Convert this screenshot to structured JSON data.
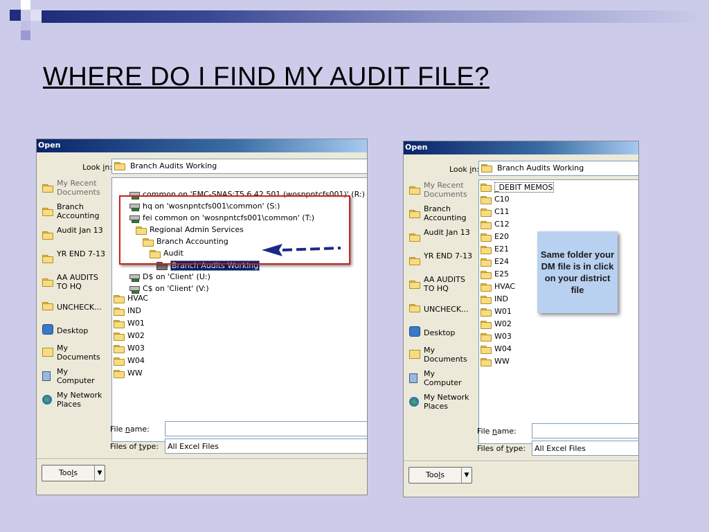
{
  "slide": {
    "title": "WHERE DO I FIND MY AUDIT FILE?",
    "background": "#ccccea",
    "accent": "#1f2d7a"
  },
  "dialog_left": {
    "title": "Open",
    "look_in_label": "Look in:",
    "look_in_value": "Branch Audits Working",
    "places": [
      {
        "label": "My Recent Documents",
        "icon": "folder-icon"
      },
      {
        "label": "Branch Accounting",
        "icon": "folder-icon"
      },
      {
        "label": "Audit Jan 13",
        "icon": "folder-icon"
      },
      {
        "label": "YR END 7-13",
        "icon": "folder-icon"
      },
      {
        "label": "AA AUDITS TO HQ",
        "icon": "folder-icon"
      },
      {
        "label": "UNCHECK...",
        "icon": "folder-icon"
      },
      {
        "label": "Desktop",
        "icon": "desktop-icon"
      },
      {
        "label": "My Documents",
        "icon": "my-documents-icon"
      },
      {
        "label": "My Computer",
        "icon": "my-computer-icon"
      },
      {
        "label": "My Network Places",
        "icon": "network-places-icon"
      }
    ],
    "tree": [
      {
        "label": "common on 'EMC-SNAS:T5.6.42.501 (wosnpntcfs001)' (R:)",
        "icon": "network-drive-icon"
      },
      {
        "label": "hq on 'wosnpntcfs001\\common' (S:)",
        "icon": "network-drive-icon"
      },
      {
        "label": "fei common on 'wosnpntcfs001\\common' (T:)",
        "icon": "network-drive-icon"
      },
      {
        "label": "Regional Admin Services",
        "icon": "folder-icon"
      },
      {
        "label": "Branch Accounting",
        "icon": "folder-icon"
      },
      {
        "label": "Audit",
        "icon": "folder-icon"
      },
      {
        "label": "Branch Audits Working",
        "icon": "folder-open-icon",
        "selected": true
      },
      {
        "label": "D$ on 'Client' (U:)",
        "icon": "network-drive-icon"
      },
      {
        "label": "C$ on 'Client' (V:)",
        "icon": "network-drive-icon"
      }
    ],
    "files": [
      "HVAC",
      "IND",
      "W01",
      "W02",
      "W03",
      "W04",
      "WW"
    ],
    "file_name_label": "File name:",
    "file_name_value": "",
    "files_of_type_label": "Files of type:",
    "files_of_type_value": "All Excel Files",
    "tools_label": "Tools"
  },
  "dialog_right": {
    "title": "Open",
    "look_in_label": "Look in:",
    "look_in_value": "Branch Audits Working",
    "places": [
      {
        "label": "My Recent Documents",
        "icon": "folder-icon"
      },
      {
        "label": "Branch Accounting",
        "icon": "folder-icon"
      },
      {
        "label": "Audit Jan 13",
        "icon": "folder-icon"
      },
      {
        "label": "YR END 7-13",
        "icon": "folder-icon"
      },
      {
        "label": "AA AUDITS TO HQ",
        "icon": "folder-icon"
      },
      {
        "label": "UNCHECK...",
        "icon": "folder-icon"
      },
      {
        "label": "Desktop",
        "icon": "desktop-icon"
      },
      {
        "label": "My Documents",
        "icon": "my-documents-icon"
      },
      {
        "label": "My Computer",
        "icon": "my-computer-icon"
      },
      {
        "label": "My Network Places",
        "icon": "network-places-icon"
      }
    ],
    "files": [
      "_DEBIT MEMOS",
      "C10",
      "C11",
      "C12",
      "E20",
      "E21",
      "E24",
      "E25",
      "HVAC",
      "IND",
      "W01",
      "W02",
      "W03",
      "W04",
      "WW"
    ],
    "file_name_label": "File name:",
    "file_name_value": "",
    "files_of_type_label": "Files of type:",
    "files_of_type_value": "All Excel Files",
    "tools_label": "Tools"
  },
  "callout": {
    "text": "Same folder your DM file is in click on your district file"
  }
}
